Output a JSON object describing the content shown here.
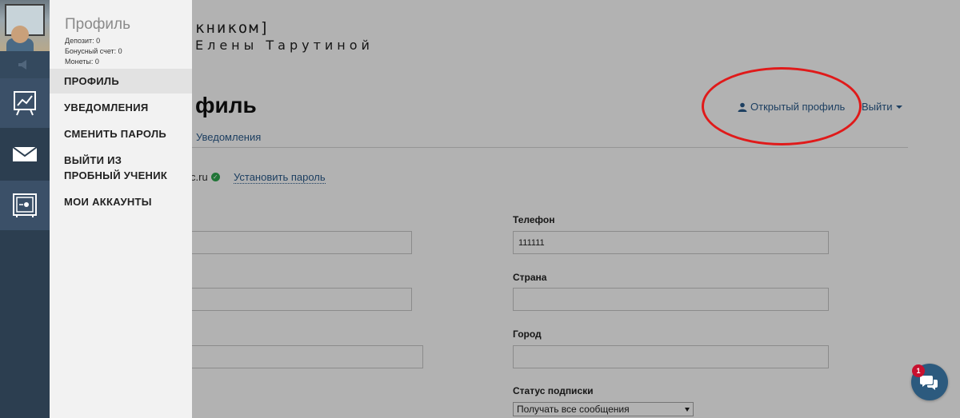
{
  "brand": {
    "line1": "кником]",
    "line2": "Елены Тарутиной"
  },
  "page": {
    "title": "филь"
  },
  "header": {
    "open_profile": "Открытый профиль",
    "logout": "Выйти"
  },
  "tabs": {
    "notifications": "Уведомления"
  },
  "account": {
    "email_fragment": "c.ru",
    "set_password": "Установить пароль"
  },
  "form": {
    "phone_label": "Телефон",
    "phone_value": "111111",
    "country_label": "Страна",
    "country_value": "",
    "city_label": "Город",
    "city_value": "",
    "subscription_label": "Статус подписки",
    "subscription_value": "Получать все сообщения"
  },
  "chat": {
    "badge": "1"
  },
  "panel": {
    "title": "Профиль",
    "deposit": "Депозит: 0",
    "bonus": "Бонусный счет: 0",
    "coins": "Монеты: 0",
    "menu": [
      {
        "label": "ПРОФИЛЬ"
      },
      {
        "label": "УВЕДОМЛЕНИЯ"
      },
      {
        "label": "СМЕНИТЬ ПАРОЛЬ"
      },
      {
        "label": "ВЫЙТИ ИЗ ПРОБНЫЙ УЧЕНИК"
      },
      {
        "label": "МОИ АККАУНТЫ"
      }
    ]
  },
  "rail": {
    "icons": [
      "speaker-icon",
      "chart-board-icon",
      "envelope-icon",
      "safe-icon"
    ]
  },
  "colors": {
    "accent_link": "#2a5b8c",
    "rail_bg": "#2c3e50",
    "annotation": "#e01a1a",
    "chat": "#2c5a7e"
  }
}
